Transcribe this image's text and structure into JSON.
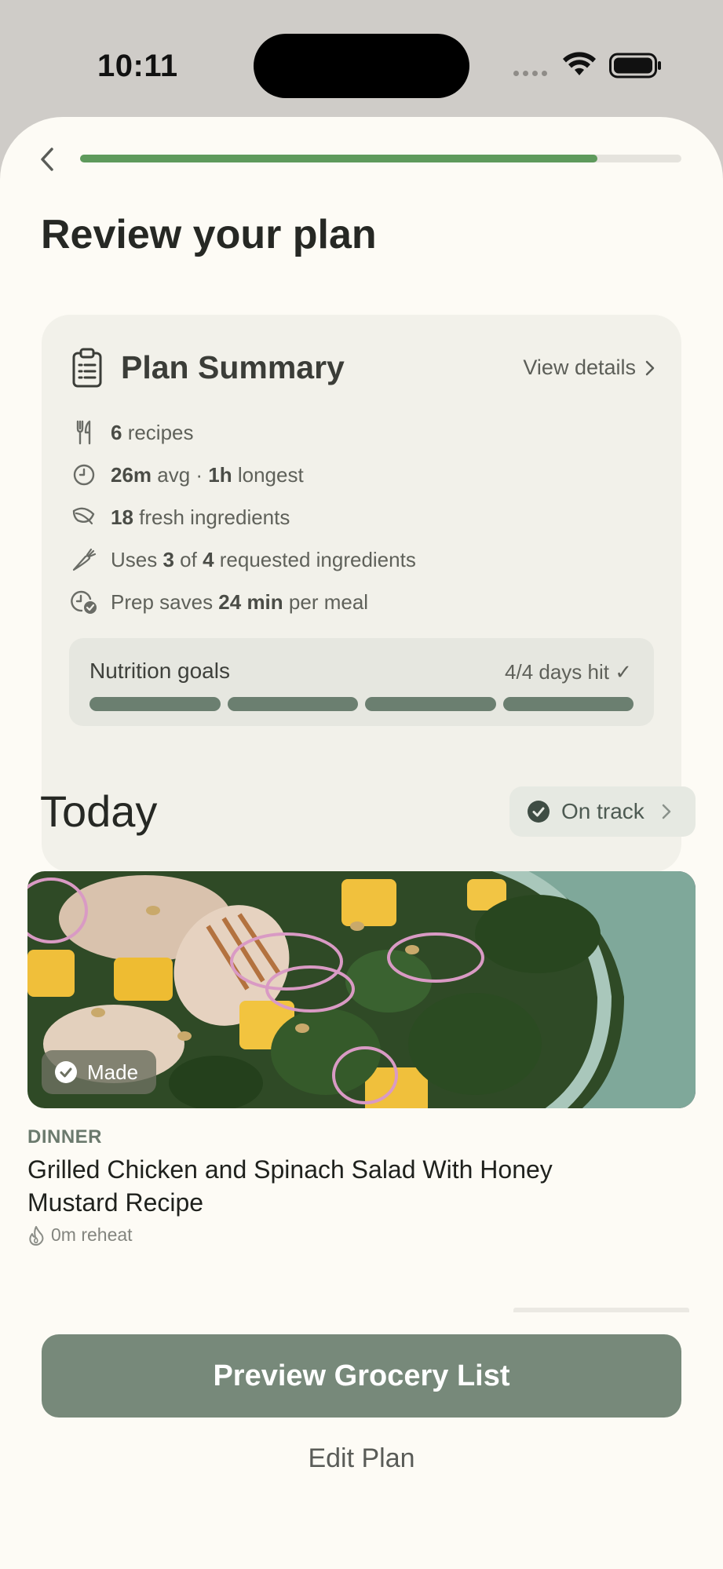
{
  "status_bar": {
    "time": "10:11"
  },
  "header": {
    "progress_fraction": 0.86
  },
  "page": {
    "title": "Review your plan"
  },
  "summary": {
    "title": "Plan Summary",
    "view_details": "View details",
    "stats": [
      {
        "icon": "fork-knife-icon",
        "parts": [
          {
            "t": "6",
            "b": true
          },
          {
            "t": " recipes",
            "b": false
          }
        ]
      },
      {
        "icon": "clock-icon",
        "parts": [
          {
            "t": "26m",
            "b": true
          },
          {
            "t": " avg · ",
            "b": false
          },
          {
            "t": "1h",
            "b": true
          },
          {
            "t": " longest",
            "b": false
          }
        ]
      },
      {
        "icon": "leaf-icon",
        "parts": [
          {
            "t": "18",
            "b": true
          },
          {
            "t": " fresh ingredients",
            "b": false
          }
        ]
      },
      {
        "icon": "carrot-icon",
        "parts": [
          {
            "t": "Uses ",
            "b": false
          },
          {
            "t": "3",
            "b": true
          },
          {
            "t": " of ",
            "b": false
          },
          {
            "t": "4",
            "b": true
          },
          {
            "t": " requested ingredients",
            "b": false
          }
        ]
      },
      {
        "icon": "clock-check-icon",
        "parts": [
          {
            "t": "Prep saves ",
            "b": false
          },
          {
            "t": "24 min",
            "b": true
          },
          {
            "t": " per meal",
            "b": false
          }
        ]
      }
    ],
    "nutrition": {
      "title": "Nutrition goals",
      "status": "4/4 days hit ✓",
      "days_hit": 4,
      "days_total": 4
    }
  },
  "today": {
    "heading": "Today",
    "status": "On track",
    "meal": {
      "badge": "Made",
      "type": "DINNER",
      "name": "Grilled Chicken and Spinach Salad With Honey Mustard Recipe",
      "reheat": "0m reheat"
    }
  },
  "actions": {
    "primary": "Preview Grocery List",
    "secondary": "Edit Plan"
  },
  "colors": {
    "accent": "#5e9a5c",
    "primary_button": "#77897a",
    "nutrition_bar": "#6b7f70"
  }
}
